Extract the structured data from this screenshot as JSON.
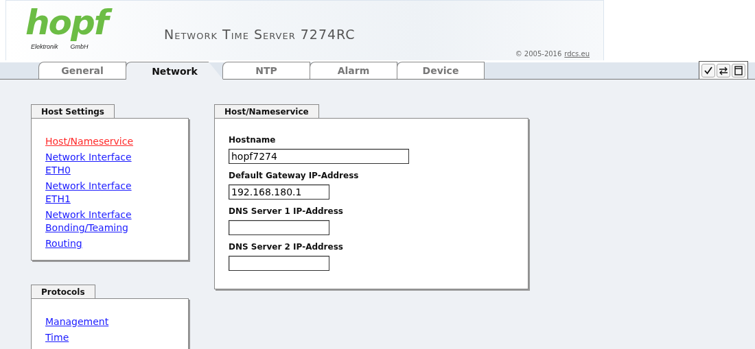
{
  "header": {
    "logo": "hopf",
    "logo_left": "Elektronik",
    "logo_right": "GmbH",
    "title": "Network Time Server 7274RC",
    "copyright": "© 2005-2016",
    "copyright_link": "rdcs.eu"
  },
  "tabs": [
    {
      "label": "General",
      "selected": false
    },
    {
      "label": "Network",
      "selected": true
    },
    {
      "label": "NTP",
      "selected": false
    },
    {
      "label": "Alarm",
      "selected": false
    },
    {
      "label": "Device",
      "selected": false
    }
  ],
  "toolbar": [
    {
      "kind": "apply"
    },
    {
      "kind": "reload"
    },
    {
      "kind": "save"
    }
  ],
  "sidebar": [
    {
      "title": "Host Settings",
      "items": [
        {
          "label": "Host/Nameservice",
          "selected": true
        },
        {
          "label": "Network Interface ETH0",
          "selected": false
        },
        {
          "label": "Network Interface ETH1",
          "selected": false
        },
        {
          "label": "Network Interface Bonding/Teaming",
          "selected": false
        },
        {
          "label": "Routing",
          "selected": false
        }
      ]
    },
    {
      "title": "Protocols",
      "items": [
        {
          "label": "Management",
          "selected": false
        },
        {
          "label": "Time",
          "selected": false
        }
      ]
    }
  ],
  "form": {
    "title": "Host/Nameservice",
    "fields": [
      {
        "label": "Hostname",
        "value": "hopf7274",
        "kind": "wide"
      },
      {
        "label": "Default Gateway IP-Address",
        "value": "192.168.180.1",
        "kind": "narrow"
      },
      {
        "label": "DNS Server 1 IP-Address",
        "kind": "narrow"
      },
      {
        "label": "DNS Server 2 IP-Address",
        "kind": "narrow"
      }
    ]
  }
}
